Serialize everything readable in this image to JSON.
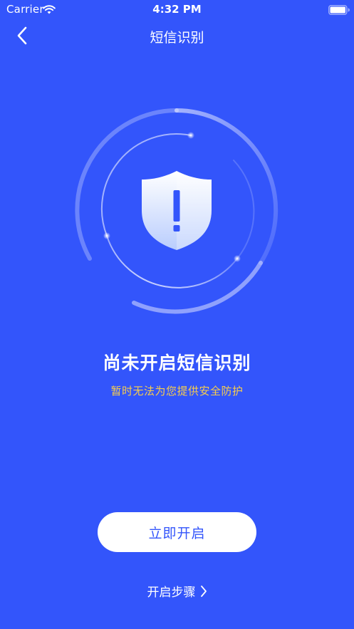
{
  "status_bar": {
    "carrier": "Carrier",
    "time": "4:32 PM",
    "wifi_icon": "wifi-icon",
    "battery_icon": "battery-full-icon"
  },
  "nav": {
    "back_icon": "chevron-left-icon",
    "title": "短信识别"
  },
  "hero": {
    "icon": "shield-exclamation-icon"
  },
  "status": {
    "title": "尚未开启短信识别",
    "subtitle": "暂时无法为您提供安全防护"
  },
  "actions": {
    "enable_label": "立即开启",
    "steps_label": "开启步骤",
    "steps_icon": "chevron-right-icon"
  },
  "colors": {
    "background": "#3355fb",
    "accent_text": "#f7cd4c",
    "button_bg": "#ffffff",
    "button_text": "#3355fb"
  }
}
